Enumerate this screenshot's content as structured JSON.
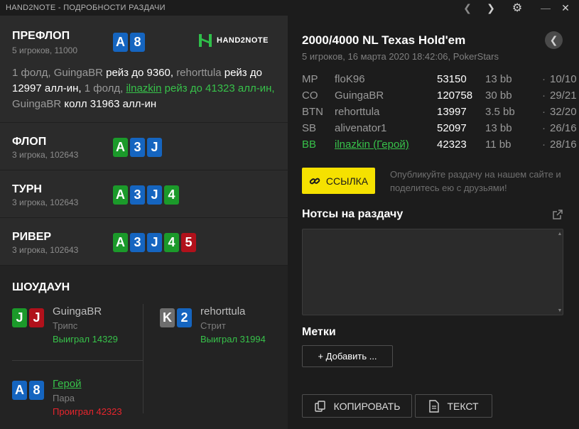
{
  "window": {
    "title": "HAND2NOTE - ПОДРОБНОСТИ РАЗДАЧИ"
  },
  "logo": {
    "text": "HAND2NOTE"
  },
  "streets": {
    "preflop": {
      "name": "ПРЕФЛОП",
      "sub": "5 игроков, 11000",
      "cards": [
        {
          "rank": "A",
          "suit": "blue"
        },
        {
          "rank": "8",
          "suit": "blue"
        }
      ],
      "action": [
        {
          "text": "1 фолд, ",
          "style": "fold"
        },
        {
          "text": "GuingaBR",
          "style": "name"
        },
        {
          "text": " рейз до 9360, ",
          "style": "act"
        },
        {
          "text": "rehorttula",
          "style": "name"
        },
        {
          "text": " рейз до 12997 алл-ин, ",
          "style": "act"
        },
        {
          "text": "1 фолд, ",
          "style": "fold"
        },
        {
          "text": "ilnazkin",
          "style": "hero-u"
        },
        {
          "text": " рейз до 41323 алл-ин, ",
          "style": "hero"
        },
        {
          "text": "GuingaBR",
          "style": "name"
        },
        {
          "text": " колл 31963 алл-ин",
          "style": "act"
        }
      ]
    },
    "flop": {
      "name": "ФЛОП",
      "sub": "3 игрока, 102643",
      "cards": [
        {
          "rank": "A",
          "suit": "green"
        },
        {
          "rank": "3",
          "suit": "blue"
        },
        {
          "rank": "J",
          "suit": "blue"
        }
      ]
    },
    "turn": {
      "name": "ТУРН",
      "sub": "3 игрока, 102643",
      "cards": [
        {
          "rank": "A",
          "suit": "green"
        },
        {
          "rank": "3",
          "suit": "blue"
        },
        {
          "rank": "J",
          "suit": "blue"
        },
        {
          "rank": "4",
          "suit": "green"
        }
      ]
    },
    "river": {
      "name": "РИВЕР",
      "sub": "3 игрока, 102643",
      "cards": [
        {
          "rank": "A",
          "suit": "green"
        },
        {
          "rank": "3",
          "suit": "blue"
        },
        {
          "rank": "J",
          "suit": "blue"
        },
        {
          "rank": "4",
          "suit": "green"
        },
        {
          "rank": "5",
          "suit": "red"
        }
      ]
    }
  },
  "showdown": {
    "title": "ШОУДАУН",
    "players": [
      {
        "name": "GuingaBR",
        "hand": "Трипс",
        "result": "Выиграл 14329",
        "outcome": "win",
        "cards": [
          {
            "rank": "J",
            "suit": "green"
          },
          {
            "rank": "J",
            "suit": "red"
          }
        ]
      },
      {
        "name": "rehorttula",
        "hand": "Стрит",
        "result": "Выиграл 31994",
        "outcome": "win",
        "cards": [
          {
            "rank": "K",
            "suit": "grey"
          },
          {
            "rank": "2",
            "suit": "blue"
          }
        ]
      },
      {
        "name": "Герой",
        "hand": "Пара",
        "result": "Проиграл 42323",
        "outcome": "loss",
        "cards": [
          {
            "rank": "A",
            "suit": "blue"
          },
          {
            "rank": "8",
            "suit": "blue"
          }
        ]
      }
    ]
  },
  "game": {
    "title": "2000/4000 NL Texas Hold'em",
    "sub": "5 игроков, 16 марта 2020 18:42:06, PokerStars"
  },
  "players": [
    {
      "pos": "MP",
      "name": "floK96",
      "stack": "53150",
      "bb": "13 bb",
      "dot": "·",
      "stats": "10/10",
      "hero": false
    },
    {
      "pos": "CO",
      "name": "GuingaBR",
      "stack": "120758",
      "bb": "30 bb",
      "dot": "·",
      "stats": "29/21",
      "hero": false
    },
    {
      "pos": "BTN",
      "name": "rehorttula",
      "stack": "13997",
      "bb": "3.5 bb",
      "dot": "·",
      "stats": "32/20",
      "hero": false
    },
    {
      "pos": "SB",
      "name": "alivenator1",
      "stack": "52097",
      "bb": "13 bb",
      "dot": "·",
      "stats": "26/16",
      "hero": false
    },
    {
      "pos": "BB",
      "name": "ilnazkin (Герой)",
      "stack": "42323",
      "bb": "11 bb",
      "dot": "·",
      "stats": "28/16",
      "hero": true
    }
  ],
  "share": {
    "link_label": "ССЫЛКА",
    "hint": "Опубликуйте раздачу на нашем сайте и поделитесь ею с друзьями!"
  },
  "notes": {
    "title": "Нотсы на раздачу",
    "value": ""
  },
  "tags": {
    "title": "Метки",
    "add_label": "+ Добавить ..."
  },
  "actions": {
    "copy_label": "КОПИРОВАТЬ",
    "text_label": "ТЕКСТ"
  },
  "colors": {
    "hero_green": "#37c24a",
    "loss_red": "#e8252d",
    "accent_yellow": "#f5e100",
    "suit_blue": "#1565c0",
    "suit_green": "#1b9a2a",
    "suit_red": "#b1111b",
    "suit_grey": "#6e6e6e"
  }
}
